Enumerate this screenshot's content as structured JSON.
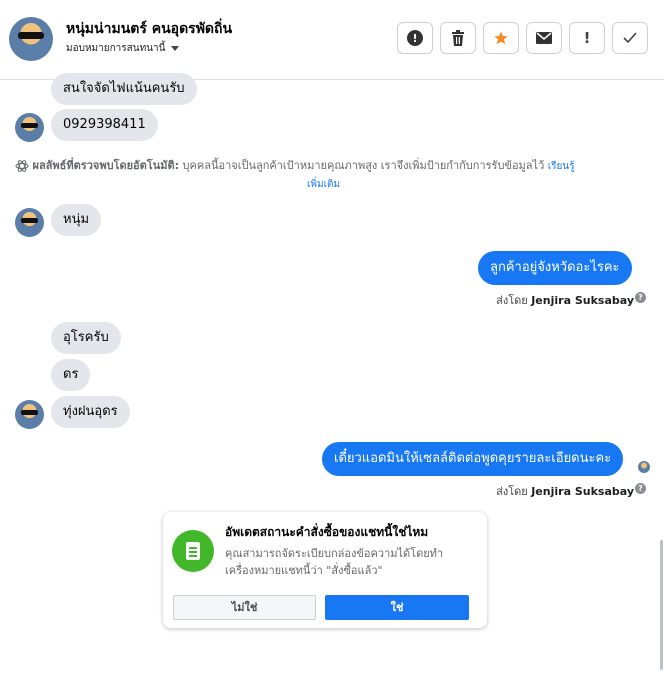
{
  "header": {
    "contact_name": "หนุ่มน่ามนตร์ คนอุดรพัดถิ่น",
    "assign_label": "มอบหมายการสนทนานี้",
    "buttons": [
      {
        "name": "spam-button",
        "icon": "alert-circle-icon"
      },
      {
        "name": "delete-button",
        "icon": "trash-icon"
      },
      {
        "name": "star-button",
        "icon": "star-icon"
      },
      {
        "name": "mark-unread-button",
        "icon": "envelope-icon"
      },
      {
        "name": "follow-up-button",
        "icon": "exclamation-icon"
      },
      {
        "name": "mark-done-button",
        "icon": "check-icon"
      }
    ],
    "star_color": "#f28c28"
  },
  "messages": {
    "m1": "สนใจจัดไฟแน้นคนรับ",
    "m2": "0929398411",
    "m3": "หนุ่ม",
    "m4": "ลูกค้าอยู่จังหวัดอะไรคะ",
    "m5": "อุโรครับ",
    "m6": "ดร",
    "m7": "ทุ่งฝนอุดร",
    "m8": "เดี๋ยวแอดมินให้เซลล์ติดต่อพูดคุยรายละเอียดนะคะ"
  },
  "auto_detect": {
    "label": "ผลลัพธ์ที่ตรวจพบโดยอัตโนมัติ:",
    "text": "บุคคลนี้อาจเป็นลูกค้าเป้าหมายคุณภาพสูง เราจึงเพิ่มป้ายกำกับการรับข้อมูลไว้",
    "link_1": "เรียนรู้",
    "link_2": "เพิ่มเติม"
  },
  "sent_by": {
    "prefix": "ส่งโดย",
    "agent": "Jenjira Suksabay",
    "help_glyph": "?"
  },
  "order_card": {
    "title": "อัพเดตสถานะคำสั่งซื้อของแชทนี้ใช่ไหม",
    "description": "คุณสามารถจัดระเบียบกล่องข้อความได้โดยทำเครื่องหมายแชทนี้ว่า \"สั่งซื้อแล้ว\"",
    "no_label": "ไม่ใช่",
    "yes_label": "ใช่"
  },
  "colors": {
    "accent": "#1877f2",
    "incoming_bubble": "#e4e6eb",
    "card_icon": "#42b72a"
  }
}
